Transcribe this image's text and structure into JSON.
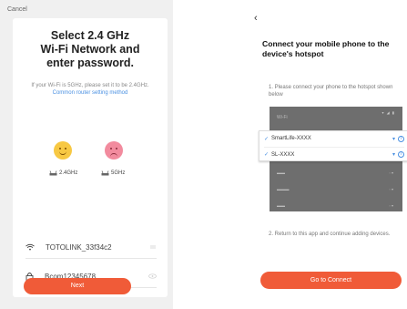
{
  "left": {
    "cancel": "Cancel",
    "title_lines": [
      "Select 2.4 GHz",
      "Wi-Fi Network and",
      "enter password."
    ],
    "note": "If your Wi-Fi is 5GHz, please set it to be 2.4GHz.",
    "note_link": "Common router setting method",
    "freq_24": "2.4GHz",
    "freq_5": "5GHz",
    "ssid": "TOTOLINK_33f34c2",
    "password": "Bcom12345678",
    "next_label": "Next"
  },
  "right": {
    "title": "Connect your mobile phone to the device's hotspot",
    "step1": "1. Please connect your phone to the hotspot shown below",
    "panel_label": "Wi-Fi",
    "networks": [
      "SmartLife-XXXX",
      "SL-XXXX"
    ],
    "step2": "2. Return to this app and continue adding devices.",
    "go_label": "Go to Connect"
  },
  "colors": {
    "accent": "#f05b38",
    "link": "#4a90e2"
  }
}
